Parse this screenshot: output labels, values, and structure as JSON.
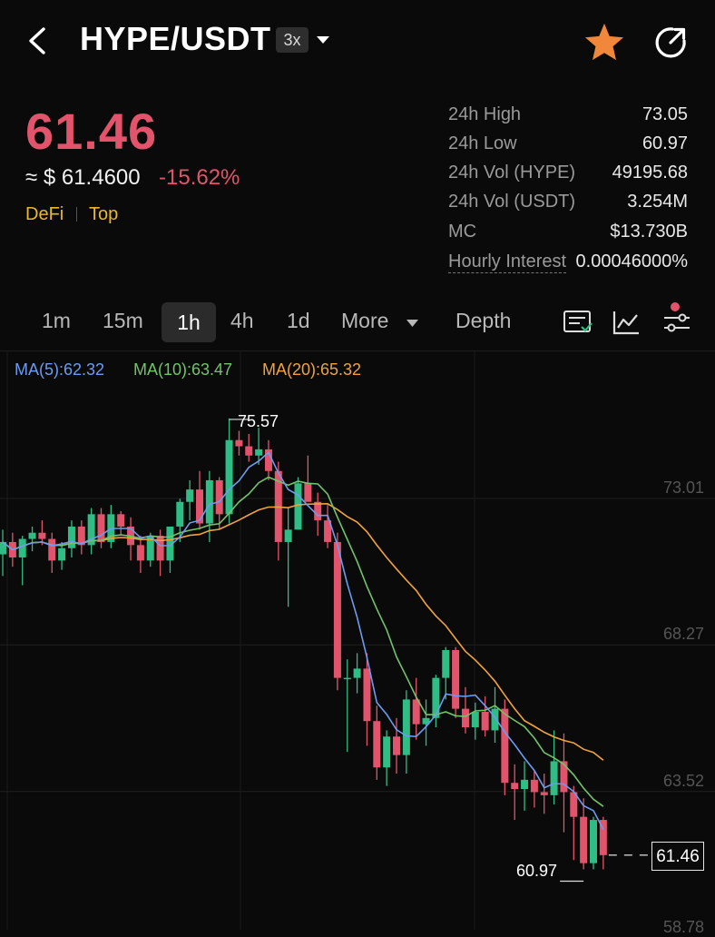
{
  "header": {
    "pair": "HYPE/USDT",
    "leverage": "3x",
    "icons": [
      "back-icon",
      "dropdown-icon",
      "star-icon",
      "share-icon"
    ],
    "star_color": "#f0873a"
  },
  "price": {
    "last": "61.46",
    "fiat": "≈ $ 61.4600",
    "change": "-15.62%",
    "tags": [
      "DeFi",
      "Top"
    ],
    "color_down": "#e2546c",
    "color_up": "#2fbd85"
  },
  "stats": [
    {
      "label": "24h High",
      "value": "73.05"
    },
    {
      "label": "24h Low",
      "value": "60.97"
    },
    {
      "label": "24h Vol (HYPE)",
      "value": "49195.68"
    },
    {
      "label": "24h Vol (USDT)",
      "value": "3.254M"
    },
    {
      "label": "MC",
      "value": "$13.730B"
    },
    {
      "label": "Hourly Interest",
      "value": "0.00046000%"
    }
  ],
  "timeframes": {
    "items": [
      "1m",
      "15m",
      "1h",
      "4h",
      "1d",
      "More",
      "Depth"
    ],
    "active": "1h"
  },
  "toolbar_icons": [
    "indicator-list-icon",
    "chart-type-icon",
    "settings-sliders-icon"
  ],
  "ma_legend": {
    "ma5": "MA(5):62.32",
    "ma10": "MA(10):63.47",
    "ma20": "MA(20):65.32",
    "ma5_color": "#6b9cf0",
    "ma10_color": "#72c46a",
    "ma20_color": "#f0a33c"
  },
  "axis": {
    "y_labels": [
      "73.01",
      "68.27",
      "63.52",
      "58.78"
    ]
  },
  "markers": {
    "high": "75.57",
    "low": "60.97",
    "current": "61.46"
  },
  "chart_data": {
    "type": "candlestick",
    "interval": "1h",
    "y_ticks": [
      73.01,
      68.27,
      63.52,
      58.78
    ],
    "high_marker": 75.57,
    "low_marker": 60.97,
    "current_price": 61.46,
    "candles": [
      [
        71.2,
        72.0,
        70.5,
        71.6
      ],
      [
        71.6,
        71.9,
        70.8,
        71.1
      ],
      [
        71.1,
        71.8,
        70.2,
        71.7
      ],
      [
        71.7,
        72.1,
        71.3,
        71.9
      ],
      [
        71.9,
        72.3,
        71.5,
        71.7
      ],
      [
        71.7,
        71.9,
        70.6,
        71.0
      ],
      [
        71.0,
        71.6,
        70.7,
        71.4
      ],
      [
        71.4,
        72.3,
        71.1,
        72.1
      ],
      [
        72.1,
        72.3,
        71.2,
        71.5
      ],
      [
        71.5,
        72.7,
        71.2,
        72.5
      ],
      [
        72.5,
        72.7,
        71.4,
        71.6
      ],
      [
        71.6,
        72.8,
        71.4,
        72.5
      ],
      [
        72.5,
        72.6,
        71.8,
        72.1
      ],
      [
        72.1,
        72.4,
        71.0,
        71.5
      ],
      [
        71.5,
        71.8,
        70.6,
        71.0
      ],
      [
        71.0,
        71.9,
        70.8,
        71.8
      ],
      [
        71.8,
        72.0,
        70.5,
        71.0
      ],
      [
        71.0,
        72.0,
        70.6,
        72.1
      ],
      [
        72.1,
        73.0,
        71.6,
        72.9
      ],
      [
        72.9,
        73.6,
        72.3,
        73.3
      ],
      [
        73.3,
        73.9,
        72.0,
        72.2
      ],
      [
        72.2,
        73.9,
        71.6,
        73.6
      ],
      [
        73.6,
        73.7,
        72.0,
        72.5
      ],
      [
        72.5,
        75.6,
        72.2,
        74.9
      ],
      [
        74.9,
        75.2,
        74.4,
        74.7
      ],
      [
        74.7,
        75.1,
        74.2,
        74.4
      ],
      [
        74.4,
        75.3,
        74.1,
        74.6
      ],
      [
        74.6,
        74.9,
        73.6,
        73.9
      ],
      [
        73.9,
        74.2,
        71.0,
        71.6
      ],
      [
        71.6,
        72.7,
        69.5,
        72.0
      ],
      [
        72.0,
        73.7,
        72.0,
        73.5
      ],
      [
        73.5,
        74.4,
        73.1,
        72.9
      ],
      [
        72.9,
        73.2,
        71.8,
        72.3
      ],
      [
        72.3,
        72.8,
        71.4,
        71.6
      ],
      [
        71.6,
        71.9,
        66.8,
        67.2
      ],
      [
        67.2,
        67.8,
        64.8,
        67.2
      ],
      [
        67.2,
        68.0,
        66.7,
        67.5
      ],
      [
        67.5,
        68.0,
        65.0,
        65.8
      ],
      [
        65.8,
        66.3,
        63.9,
        64.3
      ],
      [
        64.3,
        65.5,
        63.7,
        65.3
      ],
      [
        65.3,
        65.9,
        64.1,
        64.7
      ],
      [
        64.7,
        66.8,
        64.1,
        66.5
      ],
      [
        66.5,
        67.2,
        65.2,
        65.7
      ],
      [
        65.7,
        66.5,
        65.0,
        65.9
      ],
      [
        65.9,
        67.3,
        65.6,
        67.2
      ],
      [
        67.2,
        68.2,
        66.5,
        68.1
      ],
      [
        68.1,
        68.2,
        65.9,
        66.2
      ],
      [
        66.2,
        66.9,
        65.4,
        65.6
      ],
      [
        65.6,
        66.4,
        65.2,
        66.1
      ],
      [
        66.1,
        66.6,
        65.3,
        65.5
      ],
      [
        65.5,
        66.9,
        65.1,
        66.2
      ],
      [
        66.2,
        66.5,
        63.4,
        63.8
      ],
      [
        63.8,
        64.4,
        62.6,
        63.6
      ],
      [
        63.6,
        64.5,
        62.9,
        63.9
      ],
      [
        63.9,
        64.2,
        63.0,
        63.5
      ],
      [
        63.5,
        64.1,
        62.8,
        63.4
      ],
      [
        63.4,
        65.5,
        63.1,
        64.5
      ],
      [
        64.5,
        65.4,
        62.2,
        63.5
      ],
      [
        63.5,
        63.7,
        61.3,
        62.7
      ],
      [
        62.7,
        63.3,
        61.0,
        61.2
      ],
      [
        61.2,
        62.7,
        61.0,
        62.6
      ],
      [
        62.6,
        62.7,
        61.0,
        61.46
      ]
    ],
    "ma5_last": 62.32,
    "ma10_last": 63.47,
    "ma20_last": 65.32
  }
}
